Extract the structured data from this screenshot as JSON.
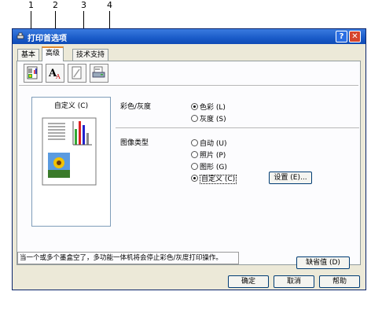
{
  "callouts": [
    "1",
    "2",
    "3",
    "4"
  ],
  "window": {
    "title": "打印首选项",
    "help_btn": "?",
    "close_btn": "✕"
  },
  "tabs": [
    {
      "label": "基本",
      "active": false
    },
    {
      "label": "高级",
      "active": true
    },
    {
      "label": "技术支持",
      "active": false
    }
  ],
  "toolbar_icons": [
    "color-page-icon",
    "font-text-icon",
    "watermark-page-icon",
    "printer-settings-icon"
  ],
  "preview": {
    "label": "自定义 (C)"
  },
  "color_group": {
    "label": "彩色/灰度",
    "options": [
      {
        "label": "色彩 (L)",
        "selected": true
      },
      {
        "label": "灰度 (S)",
        "selected": false
      }
    ]
  },
  "image_type_group": {
    "label": "图像类型",
    "options": [
      {
        "label": "自动 (U)",
        "selected": false
      },
      {
        "label": "照片 (P)",
        "selected": false
      },
      {
        "label": "图形 (G)",
        "selected": false
      },
      {
        "label": "自定义 (C)",
        "selected": true
      }
    ],
    "settings_button": "设置 (E)..."
  },
  "status_message": "当一个或多个墨盒空了，多功能一体机将会停止彩色/灰度打印操作。",
  "default_button": "缺省值 (D)",
  "footer": {
    "ok": "确定",
    "cancel": "取消",
    "help": "帮助"
  }
}
